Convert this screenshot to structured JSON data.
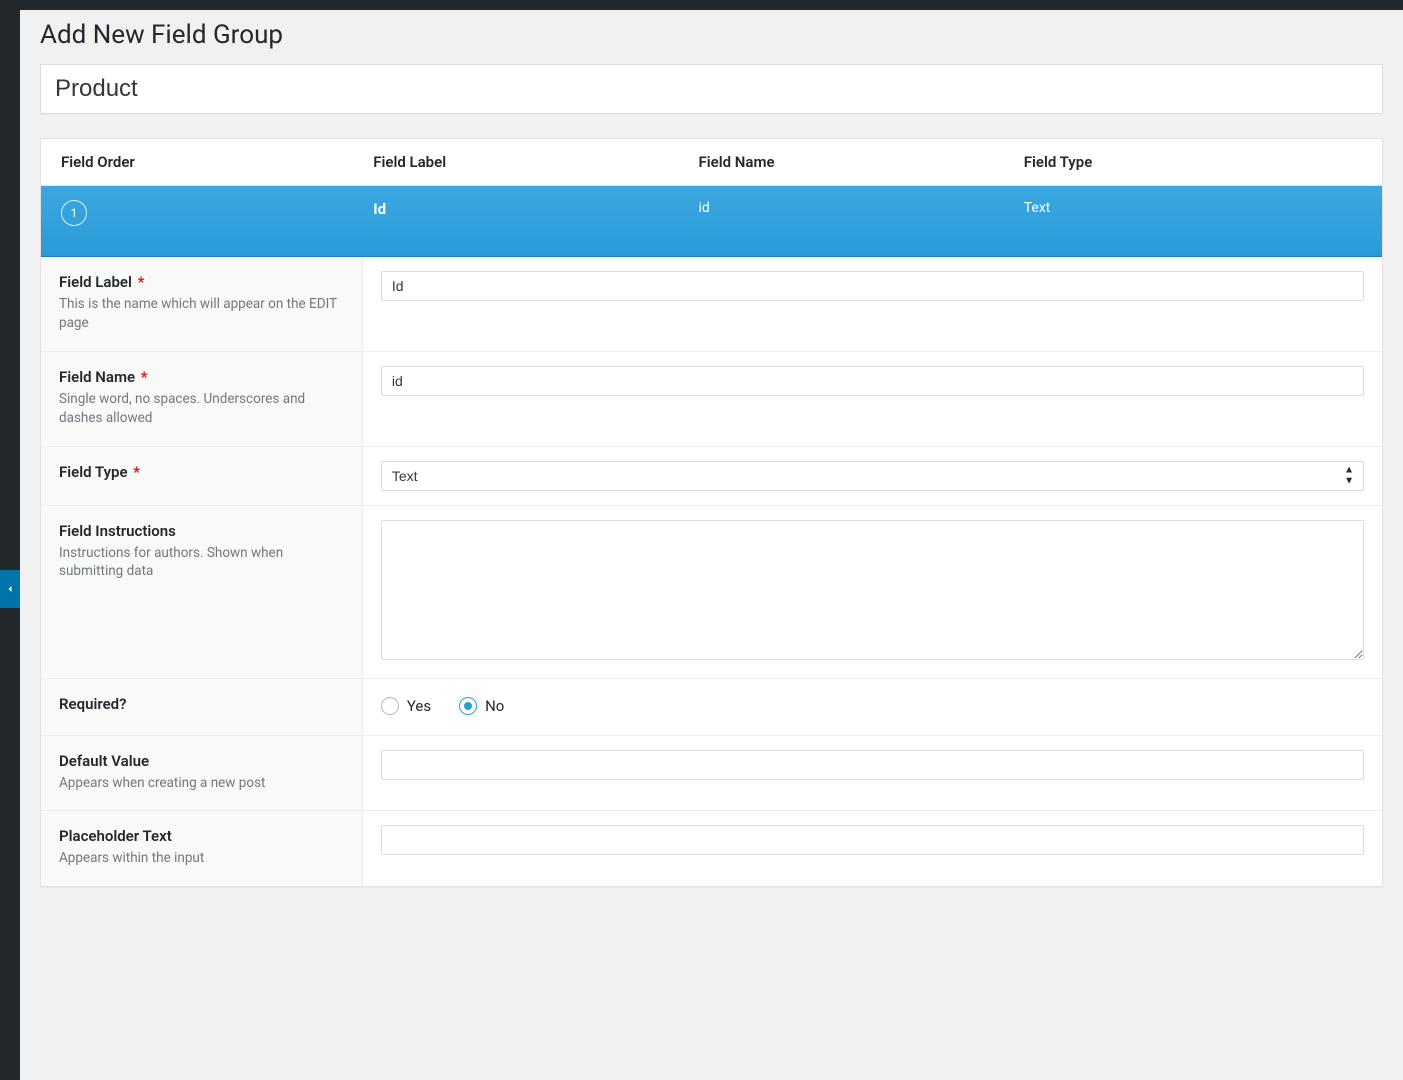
{
  "page": {
    "heading": "Add New Field Group",
    "title_value": "Product"
  },
  "table": {
    "headers": {
      "order": "Field Order",
      "label": "Field Label",
      "name": "Field Name",
      "type": "Field Type"
    },
    "row": {
      "order": "1",
      "label": "Id",
      "name": "id",
      "type": "Text"
    }
  },
  "settings": {
    "field_label": {
      "label": "Field Label",
      "required": "*",
      "desc": "This is the name which will appear on the EDIT page",
      "value": "Id"
    },
    "field_name": {
      "label": "Field Name",
      "required": "*",
      "desc": "Single word, no spaces. Underscores and dashes allowed",
      "value": "id"
    },
    "field_type": {
      "label": "Field Type",
      "required": "*",
      "value": "Text"
    },
    "instructions": {
      "label": "Field Instructions",
      "desc": "Instructions for authors. Shown when submitting data",
      "value": ""
    },
    "required": {
      "label": "Required?",
      "yes": "Yes",
      "no": "No",
      "value": "no"
    },
    "default_value": {
      "label": "Default Value",
      "desc": "Appears when creating a new post",
      "value": ""
    },
    "placeholder_text": {
      "label": "Placeholder Text",
      "desc": "Appears within the input",
      "value": ""
    }
  }
}
